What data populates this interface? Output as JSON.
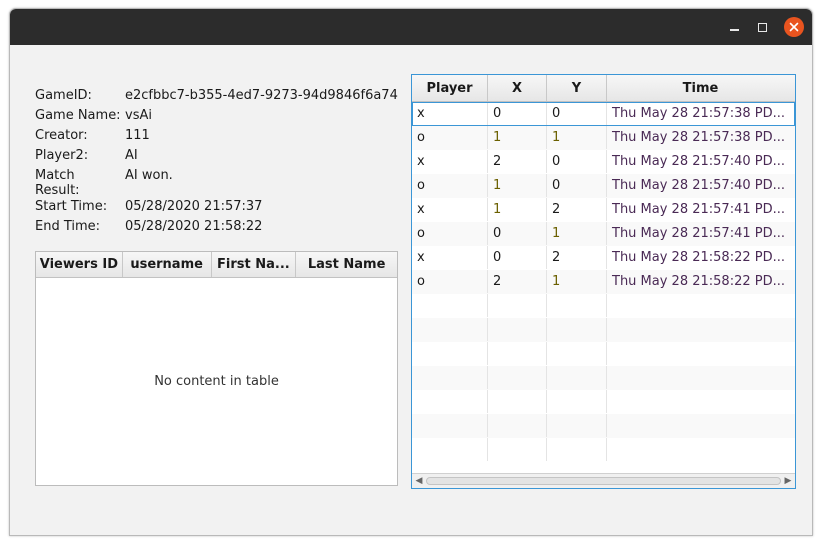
{
  "window": {
    "title": ""
  },
  "info": {
    "game_id_label": "GameID:",
    "game_id": "e2cfbbc7-b355-4ed7-9273-94d9846f6a74",
    "game_name_label": "Game Name:",
    "game_name": "vsAi",
    "creator_label": "Creator:",
    "creator": "111",
    "player2_label": "Player2:",
    "player2": "AI",
    "match_result_label": "Match\nResult:",
    "match_result": "AI won.",
    "start_time_label": "Start Time:",
    "start_time": "05/28/2020 21:57:37",
    "end_time_label": "End Time:",
    "end_time": "05/28/2020 21:58:22"
  },
  "viewers_table": {
    "columns": [
      "Viewers ID",
      "username",
      "First Na...",
      "Last Name"
    ],
    "empty_text": "No content in table"
  },
  "moves_table": {
    "columns": [
      "Player",
      "X",
      "Y",
      "Time"
    ],
    "rows": [
      {
        "player": "x",
        "x": "0",
        "y": "0",
        "time": "Thu May 28 21:57:38 PD..."
      },
      {
        "player": "o",
        "x": "1",
        "y": "1",
        "time": "Thu May 28 21:57:38 PD..."
      },
      {
        "player": "x",
        "x": "2",
        "y": "0",
        "time": "Thu May 28 21:57:40 PD..."
      },
      {
        "player": "o",
        "x": "1",
        "y": "0",
        "time": "Thu May 28 21:57:40 PD..."
      },
      {
        "player": "x",
        "x": "1",
        "y": "2",
        "time": "Thu May 28 21:57:41 PD..."
      },
      {
        "player": "o",
        "x": "0",
        "y": "1",
        "time": "Thu May 28 21:57:41 PD..."
      },
      {
        "player": "x",
        "x": "0",
        "y": "2",
        "time": "Thu May 28 21:58:22 PD..."
      },
      {
        "player": "o",
        "x": "2",
        "y": "1",
        "time": "Thu May 28 21:58:22 PD..."
      }
    ]
  },
  "colors": {
    "accent": "#3b96d6",
    "close": "#e9541f",
    "titlebar": "#2c2c2c"
  }
}
